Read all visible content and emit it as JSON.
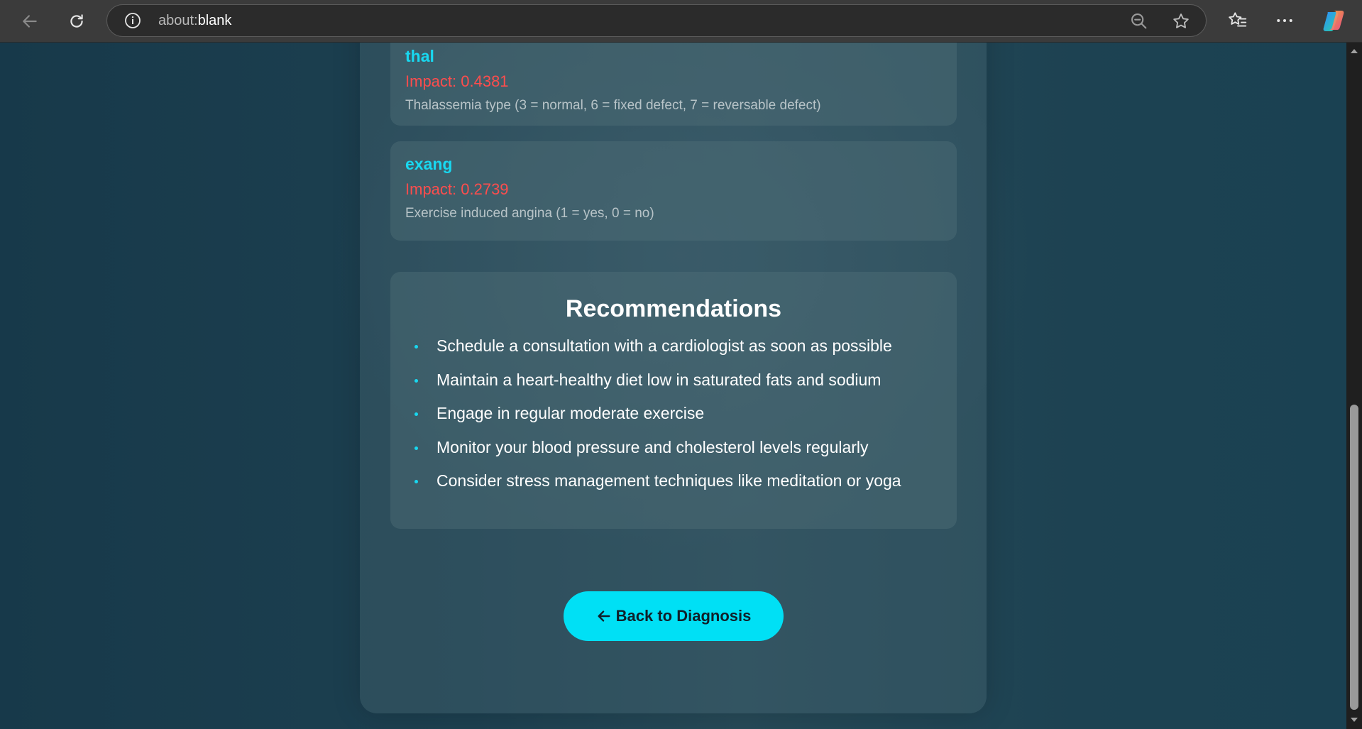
{
  "browser": {
    "url_scheme": "about:",
    "url_host": "blank",
    "icons": [
      "back-arrow-icon",
      "refresh-icon",
      "info-icon",
      "zoom-out-icon",
      "favorite-star-icon",
      "favorites-list-icon",
      "more-options-icon",
      "copilot-icon"
    ]
  },
  "features": [
    {
      "name": "thal",
      "impact": "Impact: 0.4381",
      "description": "Thalassemia type (3 = normal, 6 = fixed defect, 7 = reversable defect)"
    },
    {
      "name": "exang",
      "impact": "Impact: 0.2739",
      "description": "Exercise induced angina (1 = yes, 0 = no)"
    }
  ],
  "recommendations": {
    "title": "Recommendations",
    "items": [
      "Schedule a consultation with a cardiologist as soon as possible",
      "Maintain a heart-healthy diet low in saturated fats and sodium",
      "Engage in regular moderate exercise",
      "Monitor your blood pressure and cholesterol levels regularly",
      "Consider stress management techniques like meditation or yoga"
    ]
  },
  "back_button": {
    "label": "Back to Diagnosis",
    "icon": "left-arrow-icon"
  },
  "colors": {
    "accent": "#00e0f5",
    "feature_name": "#18d8f0",
    "impact": "#ff4d4d"
  }
}
